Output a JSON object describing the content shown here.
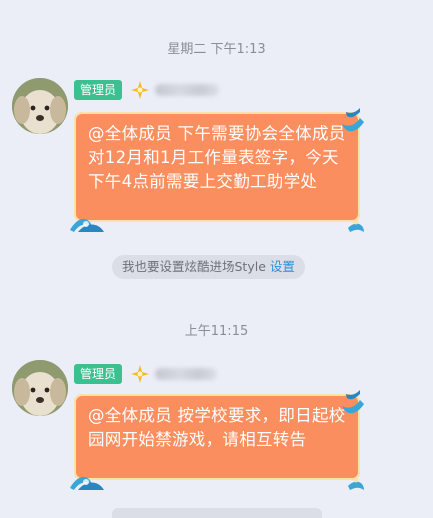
{
  "messages": [
    {
      "timestamp": "星期二 下午1:13",
      "badge": "管理员",
      "avatar": "dog-avatar",
      "level_icon": "sparkle-icon",
      "text": "@全体成员 下午需要协会全体成员对12月和1月工作量表签字，今天下午4点前需要上交勤工助学处"
    },
    {
      "timestamp": "上午11:15",
      "badge": "管理员",
      "avatar": "dog-avatar",
      "level_icon": "sparkle-icon",
      "text": "@全体成员 按学校要求，即日起校园网开始禁游戏，请相互转告"
    }
  ],
  "promo": {
    "text": "我也要设置炫酷进场Style",
    "link": "设置"
  },
  "colors": {
    "background": "#eceef7",
    "bubble": "#fb8e5e",
    "badge": "#3cc08f",
    "link": "#2a8fd6"
  }
}
